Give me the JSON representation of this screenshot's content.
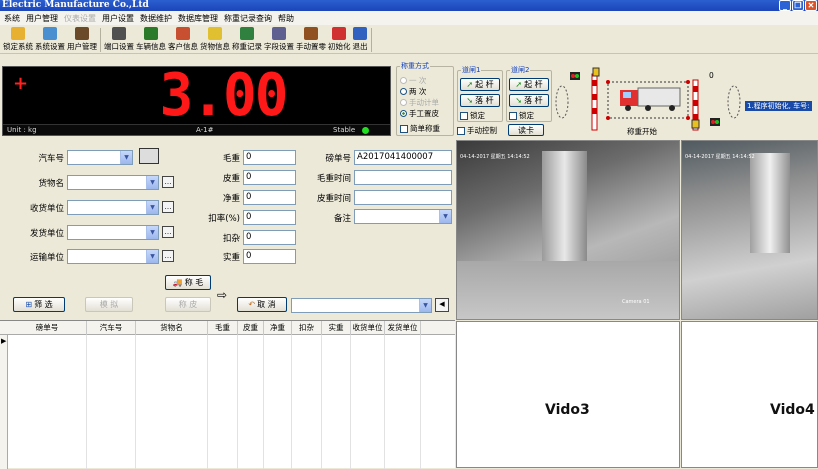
{
  "window": {
    "title": "Electric Manufacture Co.,Ltd"
  },
  "menu": [
    "系统",
    "用户管理",
    "仪表设置",
    "用户设置",
    "数据维护",
    "数据库管理",
    "称重记录查询",
    "帮助"
  ],
  "toolbar": [
    {
      "label": "锁定系统",
      "icon": "lock-icon",
      "color": "#e8b030"
    },
    {
      "label": "系统设置",
      "icon": "settings-icon",
      "color": "#4a90d0"
    },
    {
      "label": "用户管理",
      "icon": "user-icon",
      "color": "#6b4a2a"
    },
    {
      "label": "端口设置",
      "icon": "port-icon",
      "color": "#505050"
    },
    {
      "label": "车辆信息",
      "icon": "truck-icon",
      "color": "#2a7a2a"
    },
    {
      "label": "客户信息",
      "icon": "customers-icon",
      "color": "#c85030"
    },
    {
      "label": "货物信息",
      "icon": "goods-icon",
      "color": "#e0c030"
    },
    {
      "label": "称重记录",
      "icon": "records-icon",
      "color": "#308040"
    },
    {
      "label": "字段设置",
      "icon": "field-icon",
      "color": "#606090"
    },
    {
      "label": "手动置零",
      "icon": "zero-icon",
      "color": "#905020"
    },
    {
      "label": "初始化",
      "icon": "init-icon",
      "color": "#d03030"
    },
    {
      "label": "退出",
      "icon": "exit-icon",
      "color": "#3060c0"
    }
  ],
  "display": {
    "sign": "+",
    "value": "3.00",
    "unit": "Unit : kg",
    "scale": "A-1#",
    "status": "Stable"
  },
  "weigh_mode": {
    "title": "称重方式",
    "options": [
      {
        "label": "一 次",
        "selected": false,
        "disabled": true
      },
      {
        "label": "两 次",
        "selected": false,
        "disabled": false
      },
      {
        "label": "手动计单",
        "selected": false,
        "disabled": true
      },
      {
        "label": "手工置皮",
        "selected": true,
        "disabled": false
      }
    ],
    "simple_label": "简单称重"
  },
  "gate1": {
    "title": "道闸1",
    "up": "起 杆",
    "down": "落 杆",
    "lock": "锁定"
  },
  "gate2": {
    "title": "道闸2",
    "up": "起 杆",
    "down": "落 杆",
    "lock": "锁定"
  },
  "manual_control": "手动控制",
  "read_card": "读卡",
  "scene": {
    "counter": "0",
    "caption": "称重开始",
    "badge": "1.程序初始化, 车号:"
  },
  "form": {
    "left": [
      {
        "label": "汽车号",
        "value": ""
      },
      {
        "label": "货物名",
        "value": ""
      },
      {
        "label": "收货单位",
        "value": ""
      },
      {
        "label": "发货单位",
        "value": ""
      },
      {
        "label": "运输单位",
        "value": ""
      }
    ],
    "mid": [
      {
        "label": "毛重",
        "value": "0"
      },
      {
        "label": "皮重",
        "value": "0"
      },
      {
        "label": "净重",
        "value": "0"
      },
      {
        "label": "扣率(%)",
        "value": "0"
      },
      {
        "label": "扣杂",
        "value": "0"
      },
      {
        "label": "实重",
        "value": "0"
      }
    ],
    "right": [
      {
        "label": "磅单号",
        "value": "A2017041400007"
      },
      {
        "label": "毛重时间",
        "value": ""
      },
      {
        "label": "皮重时间",
        "value": ""
      },
      {
        "label": "备注",
        "value": ""
      }
    ]
  },
  "buttons": {
    "gross": "称 毛",
    "filter": "筛 选",
    "simulate": "模 拟",
    "tare": "称 皮",
    "cancel": "取 消"
  },
  "grid": {
    "headers": [
      "磅单号",
      "汽车号",
      "货物名",
      "毛重",
      "皮重",
      "净重",
      "扣杂",
      "实重",
      "收货单位",
      "发货单位"
    ]
  },
  "videos": {
    "v1_time": "04-14-2017 星期五 14:14:52",
    "v1_cam": "Camera 01",
    "v2_time": "04-14-2017 星期五 14:14:52",
    "v3": "Vido3",
    "v4": "Vido4"
  }
}
